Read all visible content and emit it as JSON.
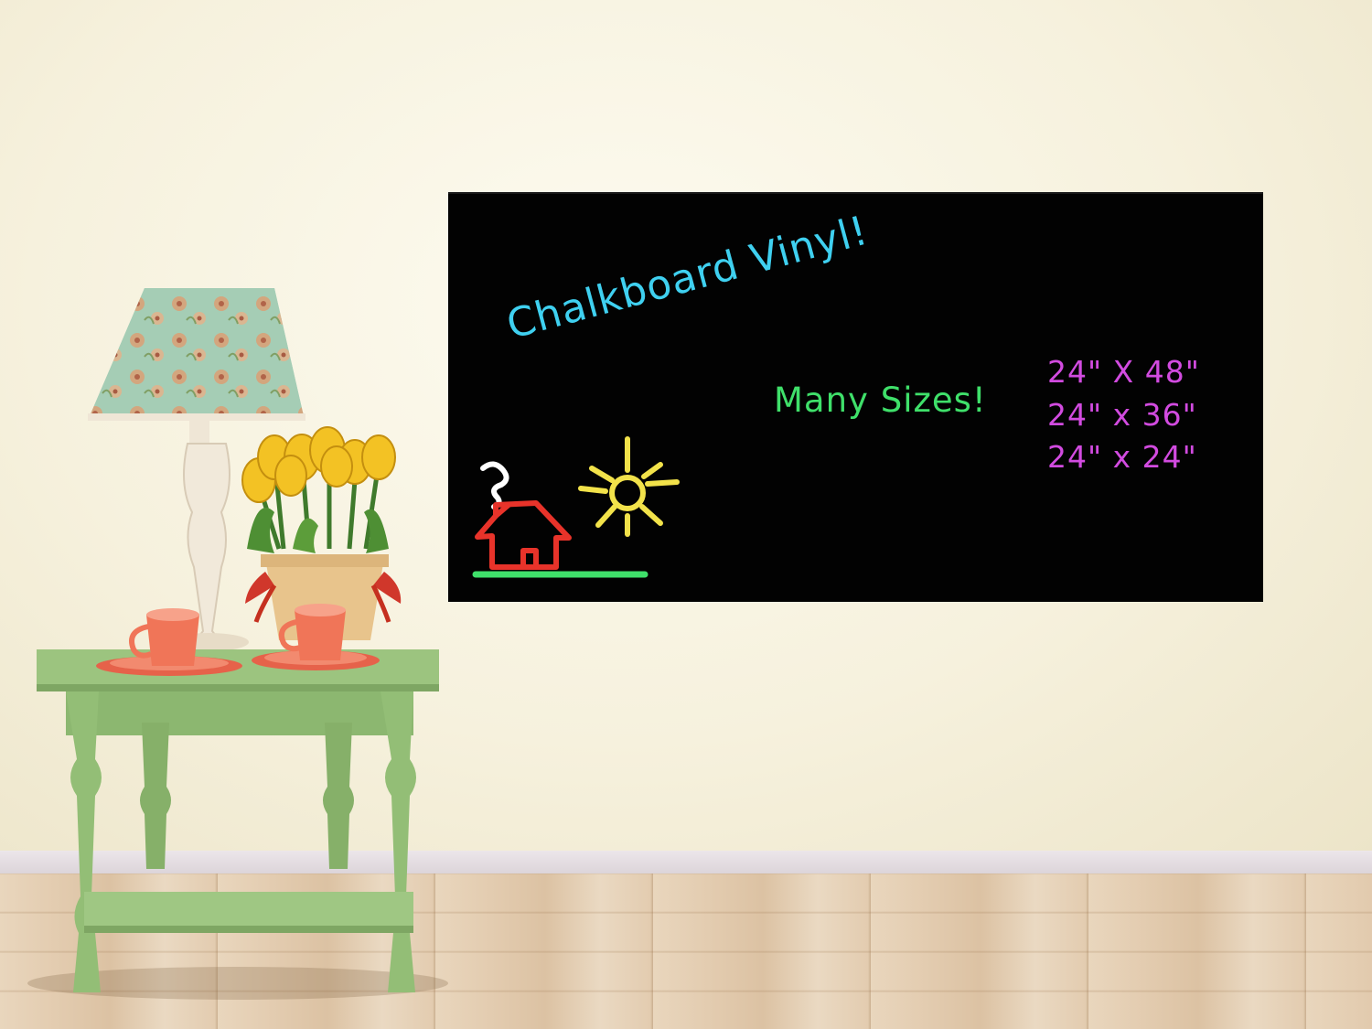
{
  "chalkboard": {
    "title": "Chalkboard Vinyl!",
    "subtitle": "Many Sizes!",
    "sizes": [
      "24\" X 48\"",
      "24\" x 36\"",
      "24\" x 24\""
    ],
    "colors": {
      "title": "#3fd0f0",
      "subtitle": "#3fe06a",
      "sizes": "#d24be0",
      "house": "#e8332a",
      "sun": "#f2e24a",
      "ground": "#3fe06a",
      "smoke": "#ffffff"
    }
  }
}
